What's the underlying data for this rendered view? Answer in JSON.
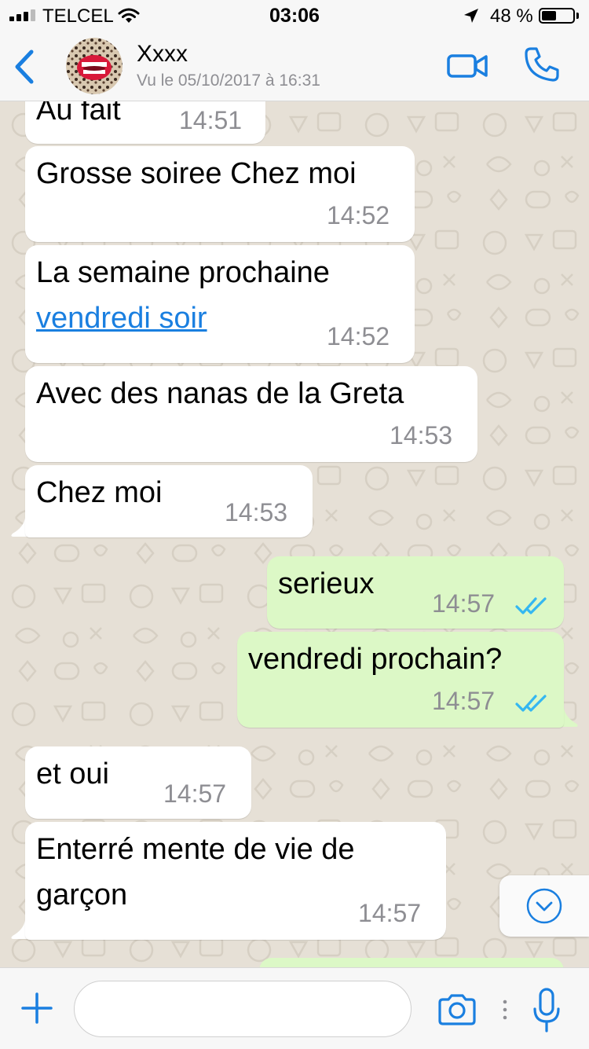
{
  "status_bar": {
    "carrier": "TELCEL",
    "time": "03:06",
    "battery_percent": "48 %",
    "battery_level": 0.48
  },
  "header": {
    "contact_name": "Xxxx",
    "last_seen": "Vu le 05/10/2017 à 16:31",
    "icons": [
      "chevron-left-icon",
      "video-camera-icon",
      "phone-icon"
    ]
  },
  "messages": [
    {
      "direction": "in",
      "text": "Au fait",
      "time": "14:51"
    },
    {
      "direction": "in",
      "text": "Grosse soiree Chez moi",
      "time": "14:52"
    },
    {
      "direction": "in",
      "text": "La semaine prochaine",
      "link": "vendredi soir",
      "time": "14:52"
    },
    {
      "direction": "in",
      "text": "Avec des nanas de la Greta",
      "time": "14:53"
    },
    {
      "direction": "in",
      "text": "Chez moi",
      "time": "14:53"
    },
    {
      "direction": "out",
      "text": "serieux",
      "time": "14:57",
      "status": "read"
    },
    {
      "direction": "out",
      "text": "vendredi prochain?",
      "time": "14:57",
      "status": "read"
    },
    {
      "direction": "in",
      "text": "et oui",
      "time": "14:57"
    },
    {
      "direction": "in",
      "text": "Enterré mente de vie de",
      "text2": "garçon",
      "time": "14:57"
    }
  ],
  "input_bar": {
    "placeholder": "",
    "icons": [
      "plus-icon",
      "camera-icon",
      "microphone-icon"
    ]
  },
  "colors": {
    "accent": "#1a7fe0",
    "incoming_bubble": "#ffffff",
    "outgoing_bubble": "#dcf8c6",
    "read_ticks": "#34b7f1",
    "chat_background": "#e6e0d6"
  }
}
